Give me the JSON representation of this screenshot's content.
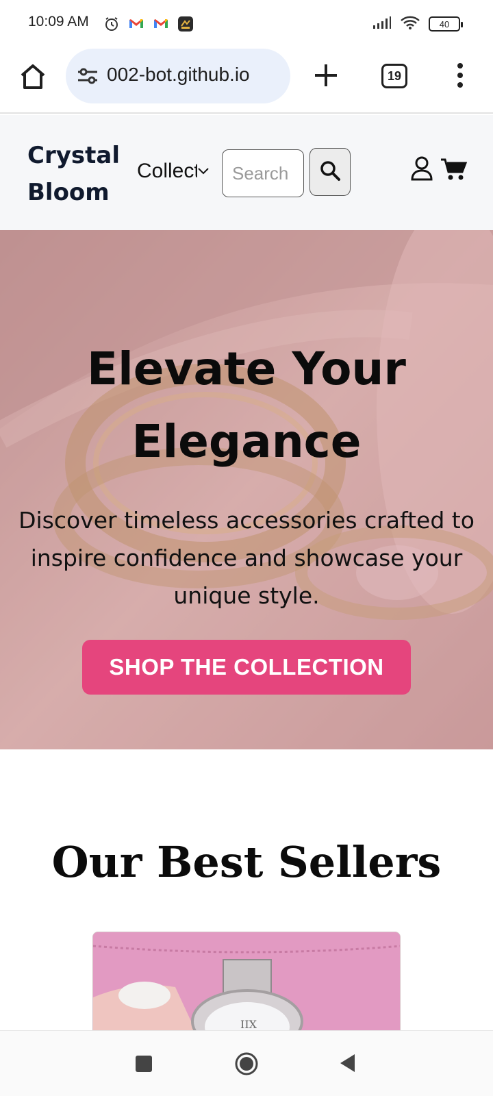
{
  "status_bar": {
    "time": "10:09 AM",
    "icons_left": [
      "alarm-icon",
      "gmail-icon",
      "gmail-icon",
      "app-notification-icon"
    ],
    "icons_right": [
      "signal-icon",
      "wifi-icon",
      "battery-icon"
    ],
    "battery": "40"
  },
  "browser": {
    "url": "002-bot.github.io",
    "tab_count": "19",
    "icons": [
      "home-icon",
      "site-settings-icon",
      "plus-icon",
      "tabs-icon",
      "more-vert-icon"
    ]
  },
  "site": {
    "brand": "Crystal Bloom",
    "nav_collections": "Collections",
    "search_placeholder": "Search",
    "icons": [
      "search-icon",
      "user-icon",
      "cart-icon",
      "chevron-down-icon"
    ]
  },
  "hero": {
    "title": "Elevate Your Elegance",
    "subtitle": "Discover timeless accessories crafted to inspire confidence and showcase your unique style.",
    "cta": "SHOP THE COLLECTION",
    "colors": {
      "cta": "#e5457d",
      "overlay": "#cfa2a3"
    }
  },
  "best_sellers": {
    "title": "Our Best Sellers"
  },
  "nav_bar": {
    "icons": [
      "recents-icon",
      "home-circle-icon",
      "back-icon"
    ]
  }
}
